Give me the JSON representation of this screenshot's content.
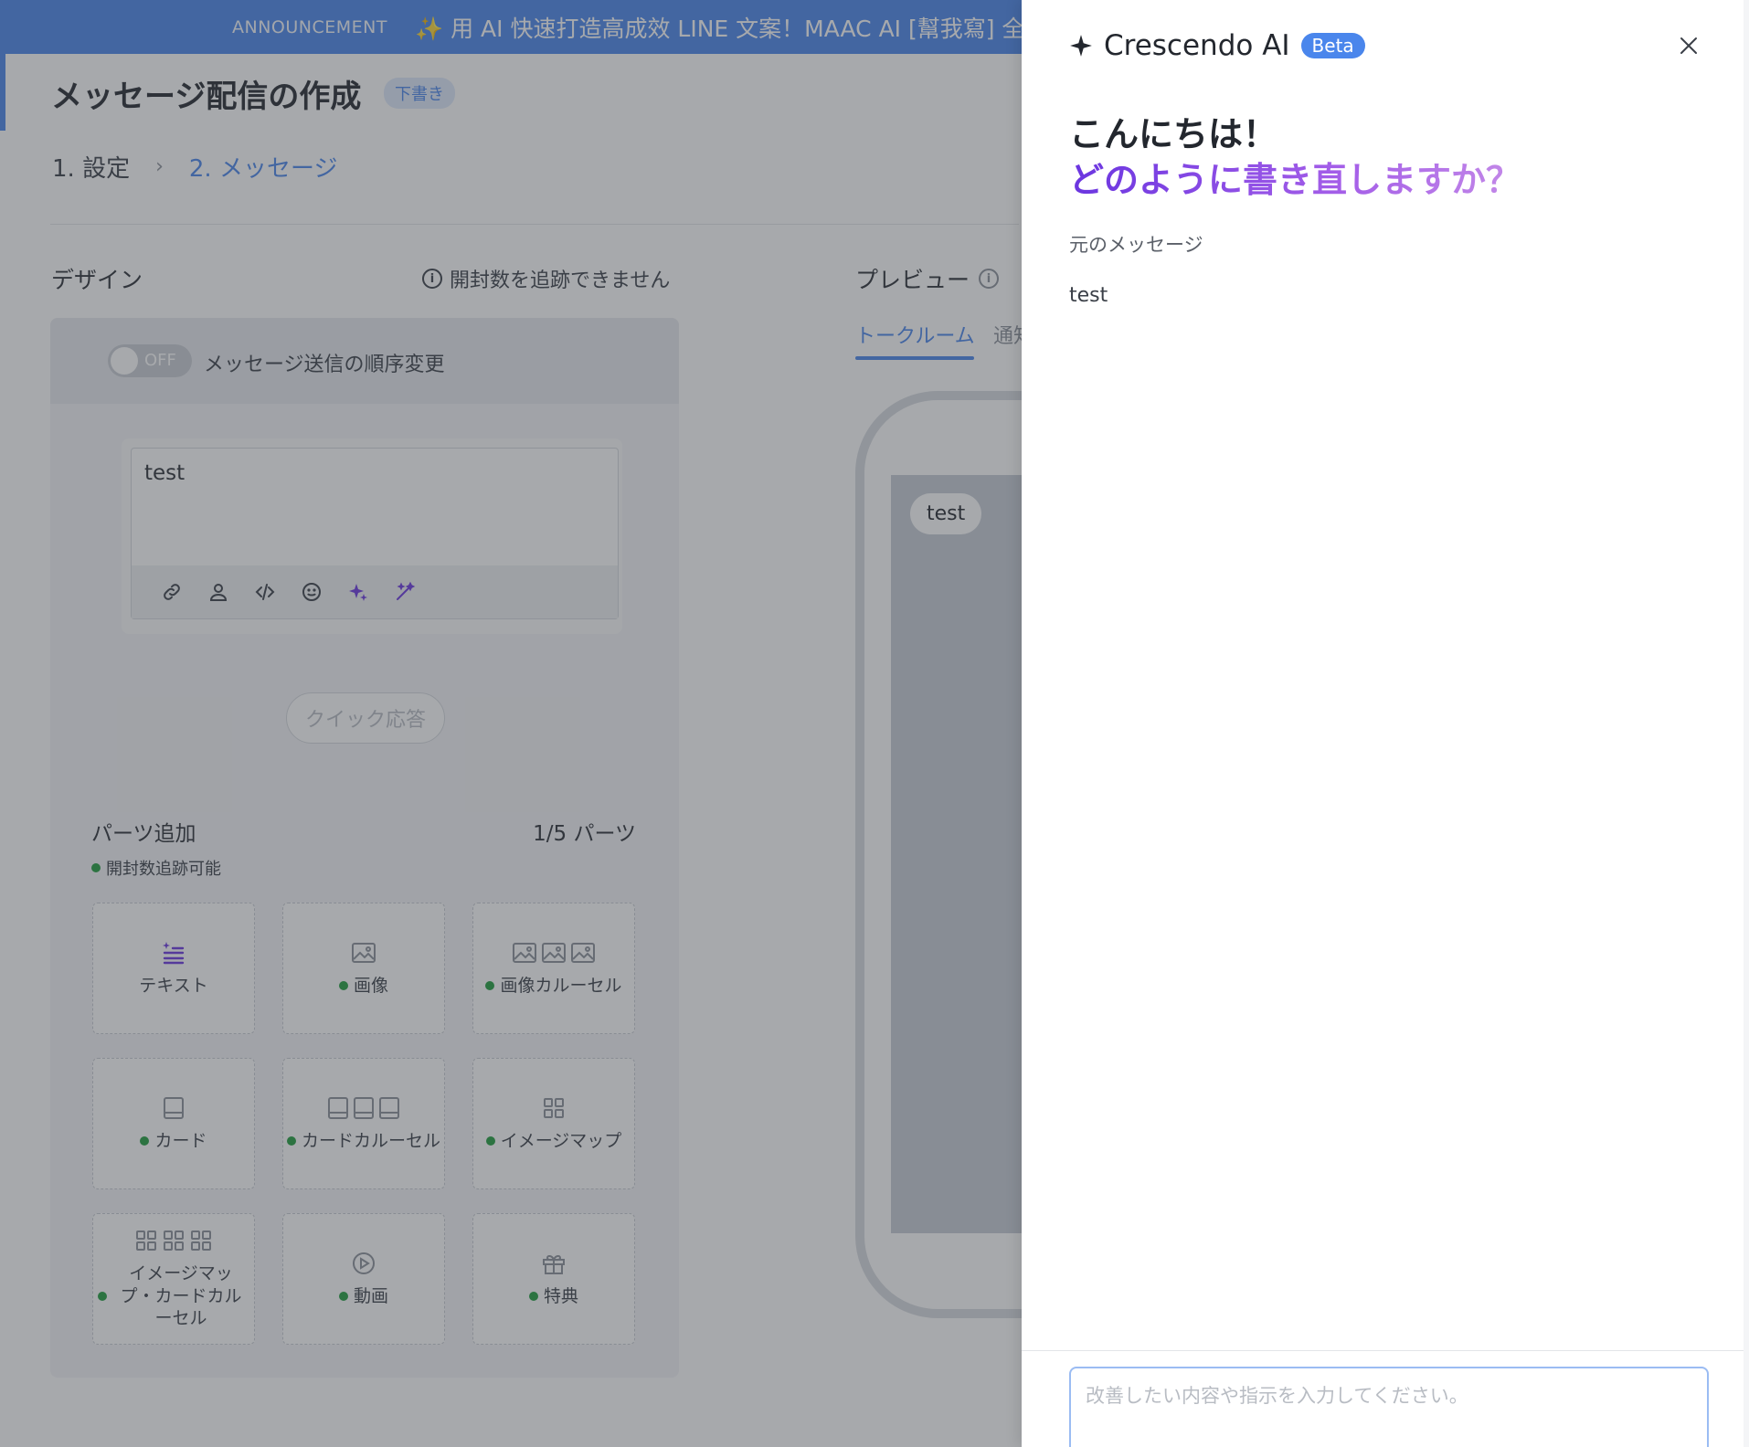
{
  "announcement": {
    "tag": "ANNOUNCEMENT",
    "message": "✨ 用 AI 快速打造高成效 LINE 文案！MAAC AI [幫我寫] 全"
  },
  "page": {
    "title": "メッセージ配信の作成",
    "status_badge": "下書き",
    "steps": [
      "1. 設定",
      "2. メッセージ"
    ],
    "step_separator": "›"
  },
  "design": {
    "label": "デザイン",
    "tracking_note": "開封数を追跡できません",
    "toggle_state": "OFF",
    "order_label": "メッセージ送信の順序変更",
    "editor_text": "test",
    "quick_reply": "クイック応答",
    "parts_label": "パーツ追加",
    "parts_count": "1/5 パーツ",
    "parts_note": "開封数追跡可能",
    "parts": [
      {
        "label": "テキスト",
        "icon": "text-icon",
        "trackable": false
      },
      {
        "label": "画像",
        "icon": "image-icon",
        "trackable": true
      },
      {
        "label": "画像カルーセル",
        "icon": "image-carousel-icon",
        "trackable": true
      },
      {
        "label": "カード",
        "icon": "card-icon",
        "trackable": true
      },
      {
        "label": "カードカルーセル",
        "icon": "card-carousel-icon",
        "trackable": true
      },
      {
        "label": "イメージマップ",
        "icon": "imagemap-icon",
        "trackable": true
      },
      {
        "label": "イメージマップ・カードカルーセル",
        "icon": "imagemap-carousel-icon",
        "trackable": true
      },
      {
        "label": "動画",
        "icon": "video-icon",
        "trackable": true
      },
      {
        "label": "特典",
        "icon": "gift-icon",
        "trackable": true
      }
    ]
  },
  "preview": {
    "label": "プレビュー",
    "tabs": [
      "トークルーム",
      "通知"
    ],
    "bubble_text": "test"
  },
  "ai_drawer": {
    "title": "Crescendo AI",
    "badge": "Beta",
    "greeting": "こんにちは！",
    "question": "どのように書き直しますか？",
    "original_label": "元のメッセージ",
    "original_text": "test",
    "input_placeholder": "改善したい内容や指示を入力してください。",
    "input_value": ""
  },
  "colors": {
    "brand": "#4a86ec",
    "ai_purple": "#6a35e0",
    "trackable_dot": "#1f9d3d"
  }
}
